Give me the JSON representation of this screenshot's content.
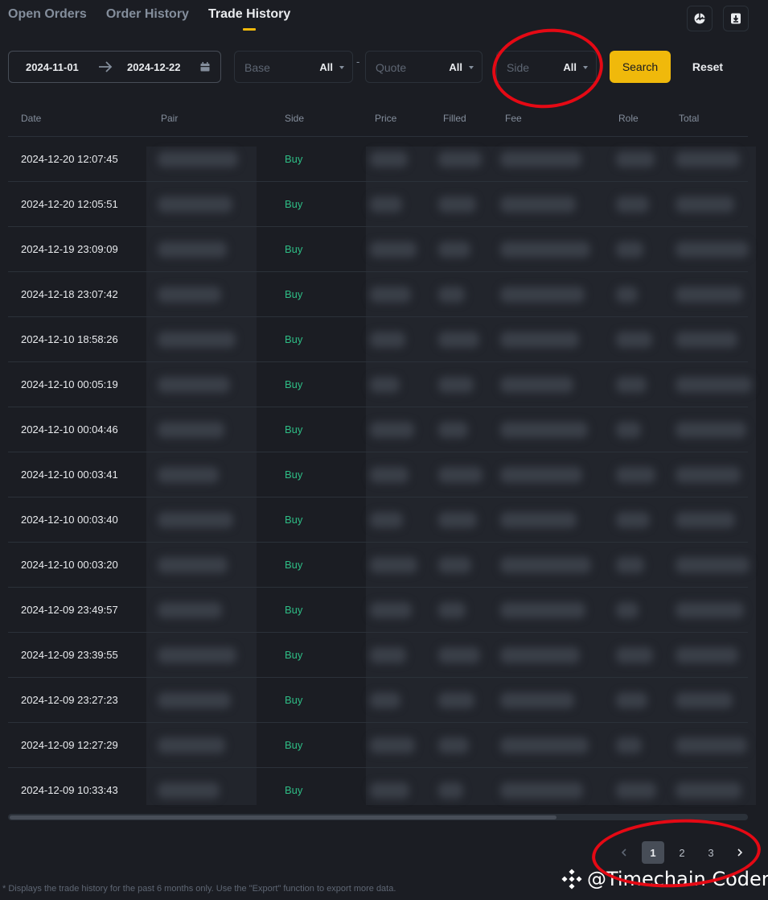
{
  "tabs": [
    {
      "label": "Open Orders",
      "active": false
    },
    {
      "label": "Order History",
      "active": false
    },
    {
      "label": "Trade History",
      "active": true
    }
  ],
  "toolbar_icons": [
    "pie-chart-icon",
    "download-icon"
  ],
  "filters": {
    "date_start": "2024-11-01",
    "date_end": "2024-12-22",
    "base": {
      "label": "Base",
      "value": "All"
    },
    "separator": "-",
    "quote": {
      "label": "Quote",
      "value": "All"
    },
    "side": {
      "label": "Side",
      "value": "All"
    },
    "search_label": "Search",
    "reset_label": "Reset"
  },
  "table": {
    "columns": [
      "Date",
      "Pair",
      "Side",
      "Price",
      "Filled",
      "Fee",
      "Role",
      "Total"
    ],
    "rows": [
      {
        "date": "2024-12-20 12:07:45",
        "side": "Buy"
      },
      {
        "date": "2024-12-20 12:05:51",
        "side": "Buy"
      },
      {
        "date": "2024-12-19 23:09:09",
        "side": "Buy"
      },
      {
        "date": "2024-12-18 23:07:42",
        "side": "Buy"
      },
      {
        "date": "2024-12-10 18:58:26",
        "side": "Buy"
      },
      {
        "date": "2024-12-10 00:05:19",
        "side": "Buy"
      },
      {
        "date": "2024-12-10 00:04:46",
        "side": "Buy"
      },
      {
        "date": "2024-12-10 00:03:41",
        "side": "Buy"
      },
      {
        "date": "2024-12-10 00:03:40",
        "side": "Buy"
      },
      {
        "date": "2024-12-10 00:03:20",
        "side": "Buy"
      },
      {
        "date": "2024-12-09 23:49:57",
        "side": "Buy"
      },
      {
        "date": "2024-12-09 23:39:55",
        "side": "Buy"
      },
      {
        "date": "2024-12-09 23:27:23",
        "side": "Buy"
      },
      {
        "date": "2024-12-09 12:27:29",
        "side": "Buy"
      },
      {
        "date": "2024-12-09 10:33:43",
        "side": "Buy"
      }
    ]
  },
  "pagination": {
    "pages": [
      "1",
      "2",
      "3"
    ],
    "current": "1"
  },
  "footnote": "* Displays the trade history for the past 6 months only. Use the \"Export\" function to export more data.",
  "watermark": "@Timechain Coder",
  "colors": {
    "accent": "#f0b90b",
    "buy": "#2ebd85",
    "annotation": "#e50914",
    "background": "#1b1d23"
  }
}
